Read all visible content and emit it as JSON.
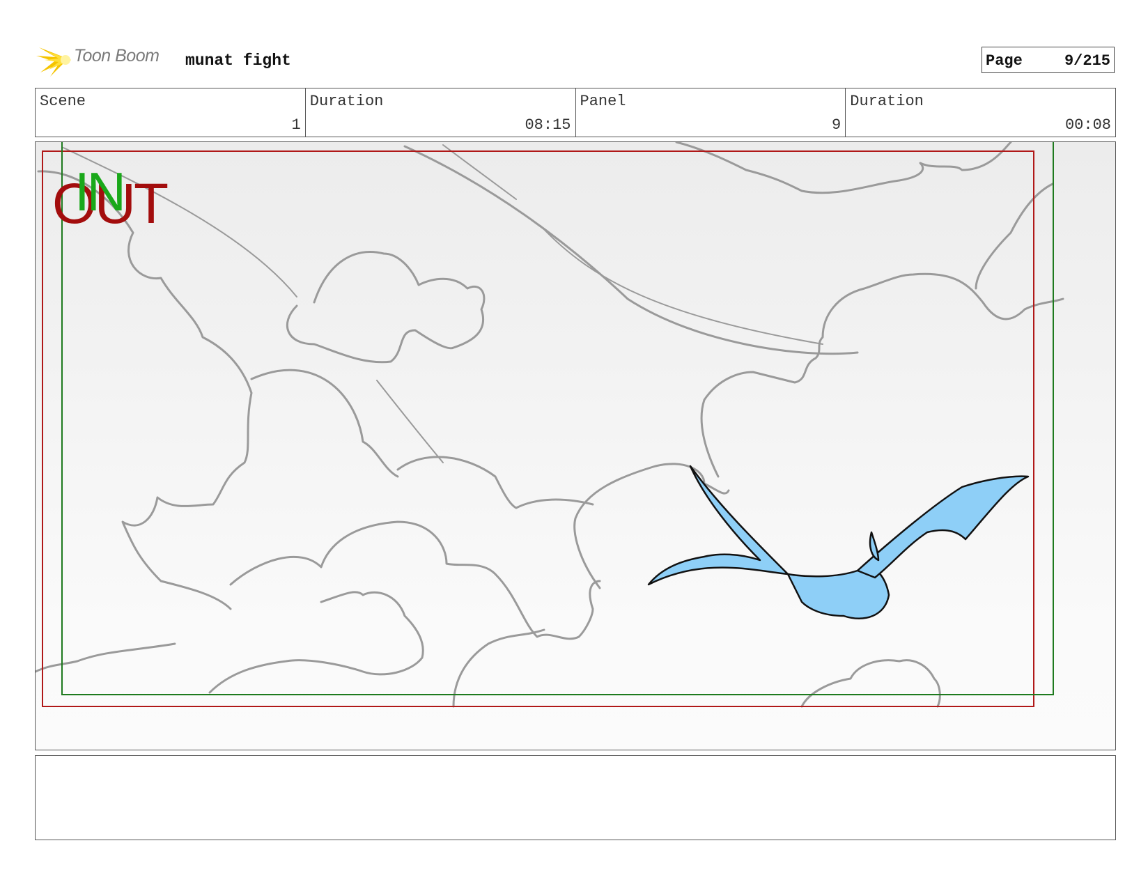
{
  "header": {
    "logo_text": "Toon Boom",
    "project_title": "munat fight",
    "page_label": "Page",
    "page_value": "9/215"
  },
  "info": {
    "scene_label": "Scene",
    "scene_value": "1",
    "scene_duration_label": "Duration",
    "scene_duration_value": "08:15",
    "panel_label": "Panel",
    "panel_value": "9",
    "panel_duration_label": "Duration",
    "panel_duration_value": "00:08"
  },
  "panel": {
    "in_label": "IN",
    "out_label": "OUT",
    "in_frame_color": "#1e7a1e",
    "out_frame_color": "#b01818",
    "sketch_color": "#9a9a9a",
    "creature_fill": "#8ecff7"
  },
  "notes": {
    "text": ""
  }
}
